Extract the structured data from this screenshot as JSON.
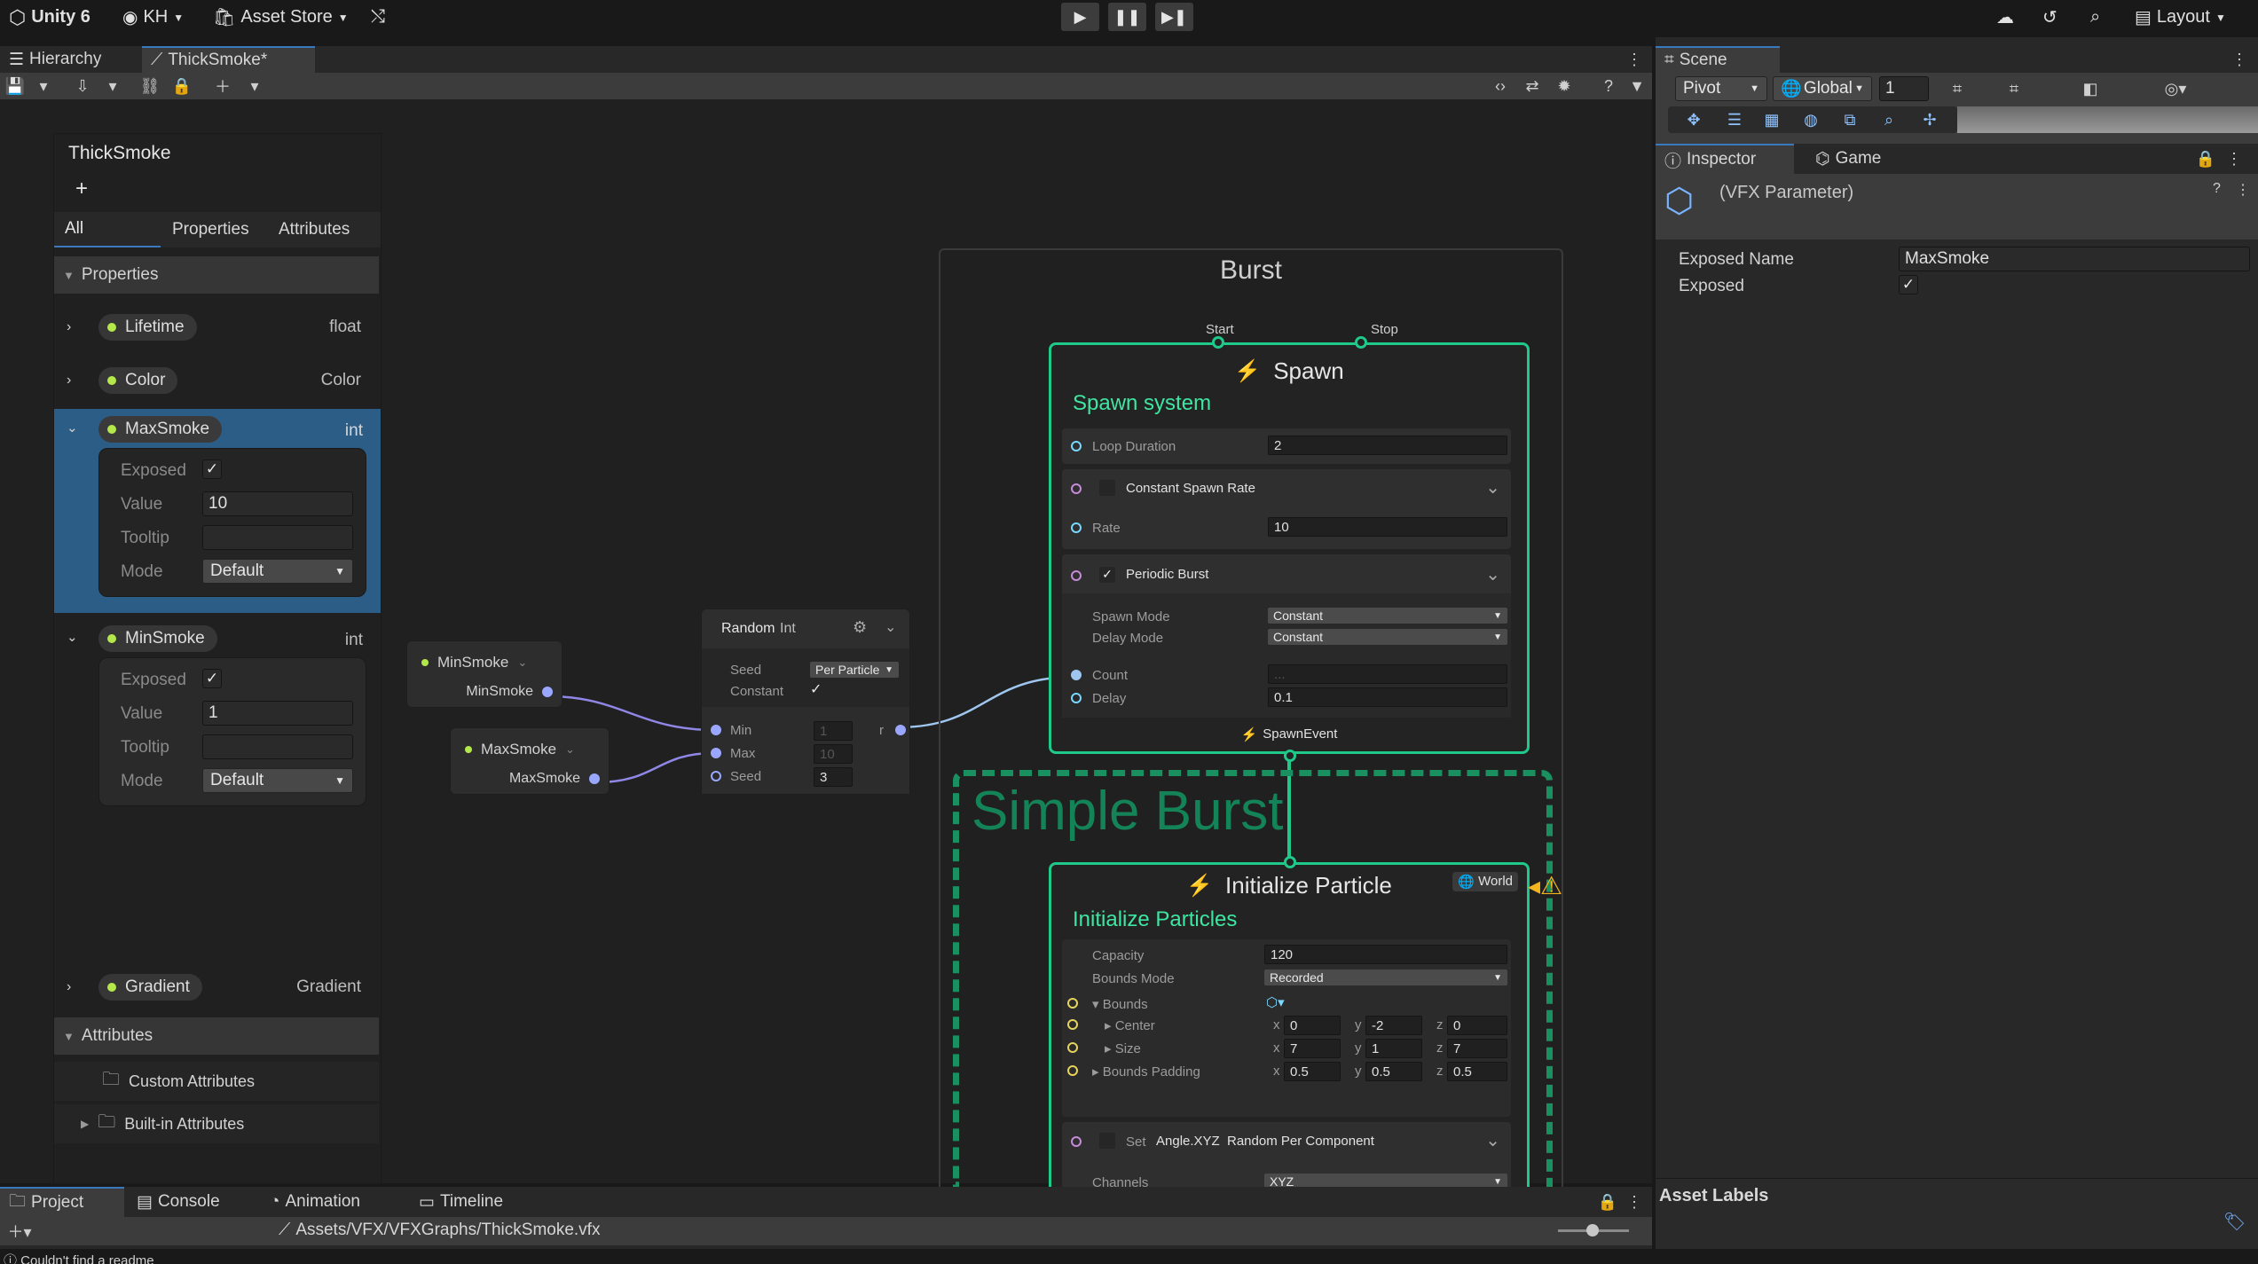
{
  "app": {
    "name": "Unity 6",
    "account": "KH",
    "asset_store": "Asset Store",
    "layout": "Layout"
  },
  "tabs": {
    "hierarchy": "Hierarchy",
    "graph": "ThickSmoke*",
    "scene": "Scene",
    "inspector": "Inspector",
    "game": "Game"
  },
  "scene_toolbar": {
    "pivot": "Pivot",
    "global": "Global",
    "grid_value": "1"
  },
  "blackboard": {
    "title": "ThickSmoke",
    "add": "+",
    "tabs": [
      "All",
      "Properties",
      "Attributes"
    ],
    "properties_header": "Properties",
    "props": [
      {
        "name": "Lifetime",
        "type": "float"
      },
      {
        "name": "Color",
        "type": "Color"
      },
      {
        "name": "MaxSmoke",
        "type": "int"
      },
      {
        "name": "MinSmoke",
        "type": "int"
      },
      {
        "name": "Gradient",
        "type": "Gradient"
      }
    ],
    "maxsmoke": {
      "exposed_label": "Exposed",
      "value_label": "Value",
      "value": "10",
      "tooltip_label": "Tooltip",
      "mode_label": "Mode",
      "mode": "Default"
    },
    "minsmoke": {
      "exposed_label": "Exposed",
      "value_label": "Value",
      "value": "1",
      "tooltip_label": "Tooltip",
      "mode_label": "Mode",
      "mode": "Default"
    },
    "attributes_header": "Attributes",
    "custom_attributes": "Custom Attributes",
    "builtin_attributes": "Built-in Attributes"
  },
  "graph": {
    "minsmoke_node": {
      "title": "MinSmoke",
      "out": "MinSmoke"
    },
    "maxsmoke_node": {
      "title": "MaxSmoke",
      "out": "MaxSmoke"
    },
    "random_node": {
      "title": "Random",
      "type": "Int",
      "seed_label": "Seed",
      "seed_mode": "Per Particle",
      "constant_label": "Constant",
      "min_label": "Min",
      "min": "1",
      "max_label": "Max",
      "max": "10",
      "seed2_label": "Seed",
      "seed": "3",
      "out": "r"
    },
    "burst_system": {
      "title": "Burst",
      "start": "Start",
      "stop": "Stop"
    },
    "spawn": {
      "title": "Spawn",
      "subtitle": "Spawn system",
      "loop_duration_label": "Loop Duration",
      "loop_duration": "2",
      "constant_rate_label": "Constant Spawn Rate",
      "rate_label": "Rate",
      "rate": "10",
      "periodic_label": "Periodic Burst",
      "spawn_mode_label": "Spawn Mode",
      "spawn_mode": "Constant",
      "delay_mode_label": "Delay Mode",
      "delay_mode": "Constant",
      "count_label": "Count",
      "count": "...",
      "delay_label": "Delay",
      "delay": "0.1",
      "event": "SpawnEvent"
    },
    "simple_burst": "Simple Burst",
    "init": {
      "title": "Initialize Particle",
      "subtitle": "Initialize Particles",
      "space": "World",
      "capacity_label": "Capacity",
      "capacity": "120",
      "bounds_mode_label": "Bounds Mode",
      "bounds_mode": "Recorded",
      "bounds_label": "Bounds",
      "center_label": "Center",
      "center": {
        "x": "0",
        "y": "-2",
        "z": "0"
      },
      "size_label": "Size",
      "size": {
        "x": "7",
        "y": "1",
        "z": "7"
      },
      "padding_label": "Bounds Padding",
      "padding": {
        "x": "0.5",
        "y": "0.5",
        "z": "0.5"
      },
      "set_label": "Set",
      "set_attr": "Angle.XYZ",
      "set_mode": "Random Per Component",
      "channels_label": "Channels",
      "channels": "XYZ"
    }
  },
  "inspector": {
    "title": "(VFX Parameter)",
    "exposed_name_label": "Exposed Name",
    "exposed_name": "MaxSmoke",
    "exposed_label": "Exposed",
    "asset_labels": "Asset Labels"
  },
  "bottom": {
    "tabs": [
      "Project",
      "Console",
      "Animation",
      "Timeline"
    ],
    "path": "Assets/VFX/VFXGraphs/ThickSmoke.vfx",
    "status": "Couldn't find a readme"
  },
  "colors": {
    "accent": "#1fc98a",
    "selection": "#2c5d87",
    "warning": "#f2b51f",
    "port": "#9aa7ff"
  }
}
